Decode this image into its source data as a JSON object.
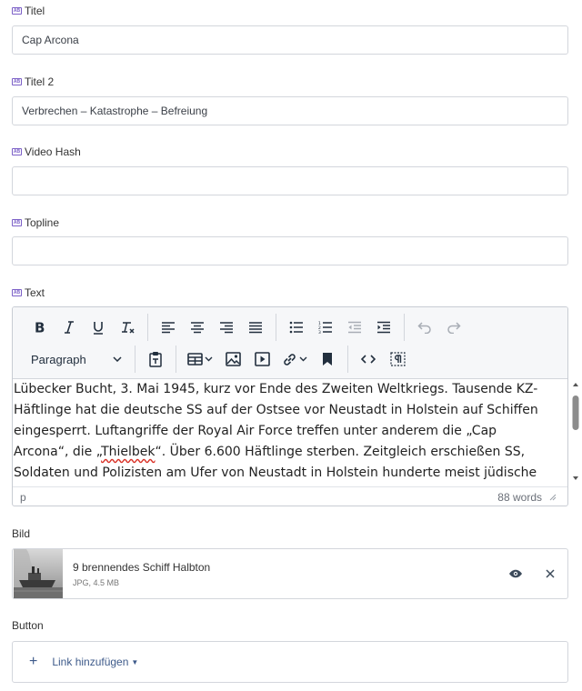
{
  "fields": {
    "title": {
      "label": "Titel",
      "value": "Cap Arcona",
      "lang_icon": "translatable-icon"
    },
    "title2": {
      "label": "Titel 2",
      "value": "Verbrechen – Katastrophe – Befreiung",
      "lang_icon": "translatable-icon"
    },
    "video_hash": {
      "label": "Video Hash",
      "value": "",
      "lang_icon": "translatable-icon"
    },
    "topline": {
      "label": "Topline",
      "value": "",
      "lang_icon": "translatable-icon"
    },
    "text": {
      "label": "Text",
      "lang_icon": "translatable-icon"
    }
  },
  "lang_badge": "AB",
  "editor": {
    "block_format": "Paragraph",
    "toolbar_row1": [
      "bold",
      "italic",
      "underline",
      "clear-formatting",
      "align-left",
      "align-center",
      "align-right",
      "justify",
      "bullet-list",
      "numbered-list",
      "outdent",
      "indent",
      "undo",
      "redo"
    ],
    "toolbar_row2": [
      "paragraph-select",
      "paste-as-text",
      "table",
      "image",
      "media",
      "link",
      "bookmark",
      "source-code",
      "show-blocks"
    ],
    "content_before": "Lübecker Bucht, 3. Mai 1945, kurz vor Ende des Zweiten Weltkriegs. Tausende KZ-Häftlinge hat die deutsche SS auf der Ostsee vor Neustadt in Holstein auf Schiffen eingesperrt. Luftangriffe der Royal Air Force treffen unter anderem die „Cap Arcona“, die „",
    "content_misspelled": "Thielbek",
    "content_after": "“. Über 6.600 Häftlinge sterben. Zeitgleich erschießen SS, Soldaten und Polizisten am Ufer von Neustadt in Holstein hunderte meist jüdische",
    "path": "p",
    "word_count": "88 words"
  },
  "image": {
    "label": "Bild",
    "name": "9 brennendes Schiff Halbton",
    "info": "JPG, 4.5 MB"
  },
  "button": {
    "label": "Button",
    "add_link_label": "Link hinzufügen"
  },
  "colors": {
    "accent": "#7b5fc7",
    "link": "#3d5a8a",
    "border": "#d3d6dc",
    "toolbar_bg": "#f6f7f9",
    "spelling_error": "#d93025"
  }
}
